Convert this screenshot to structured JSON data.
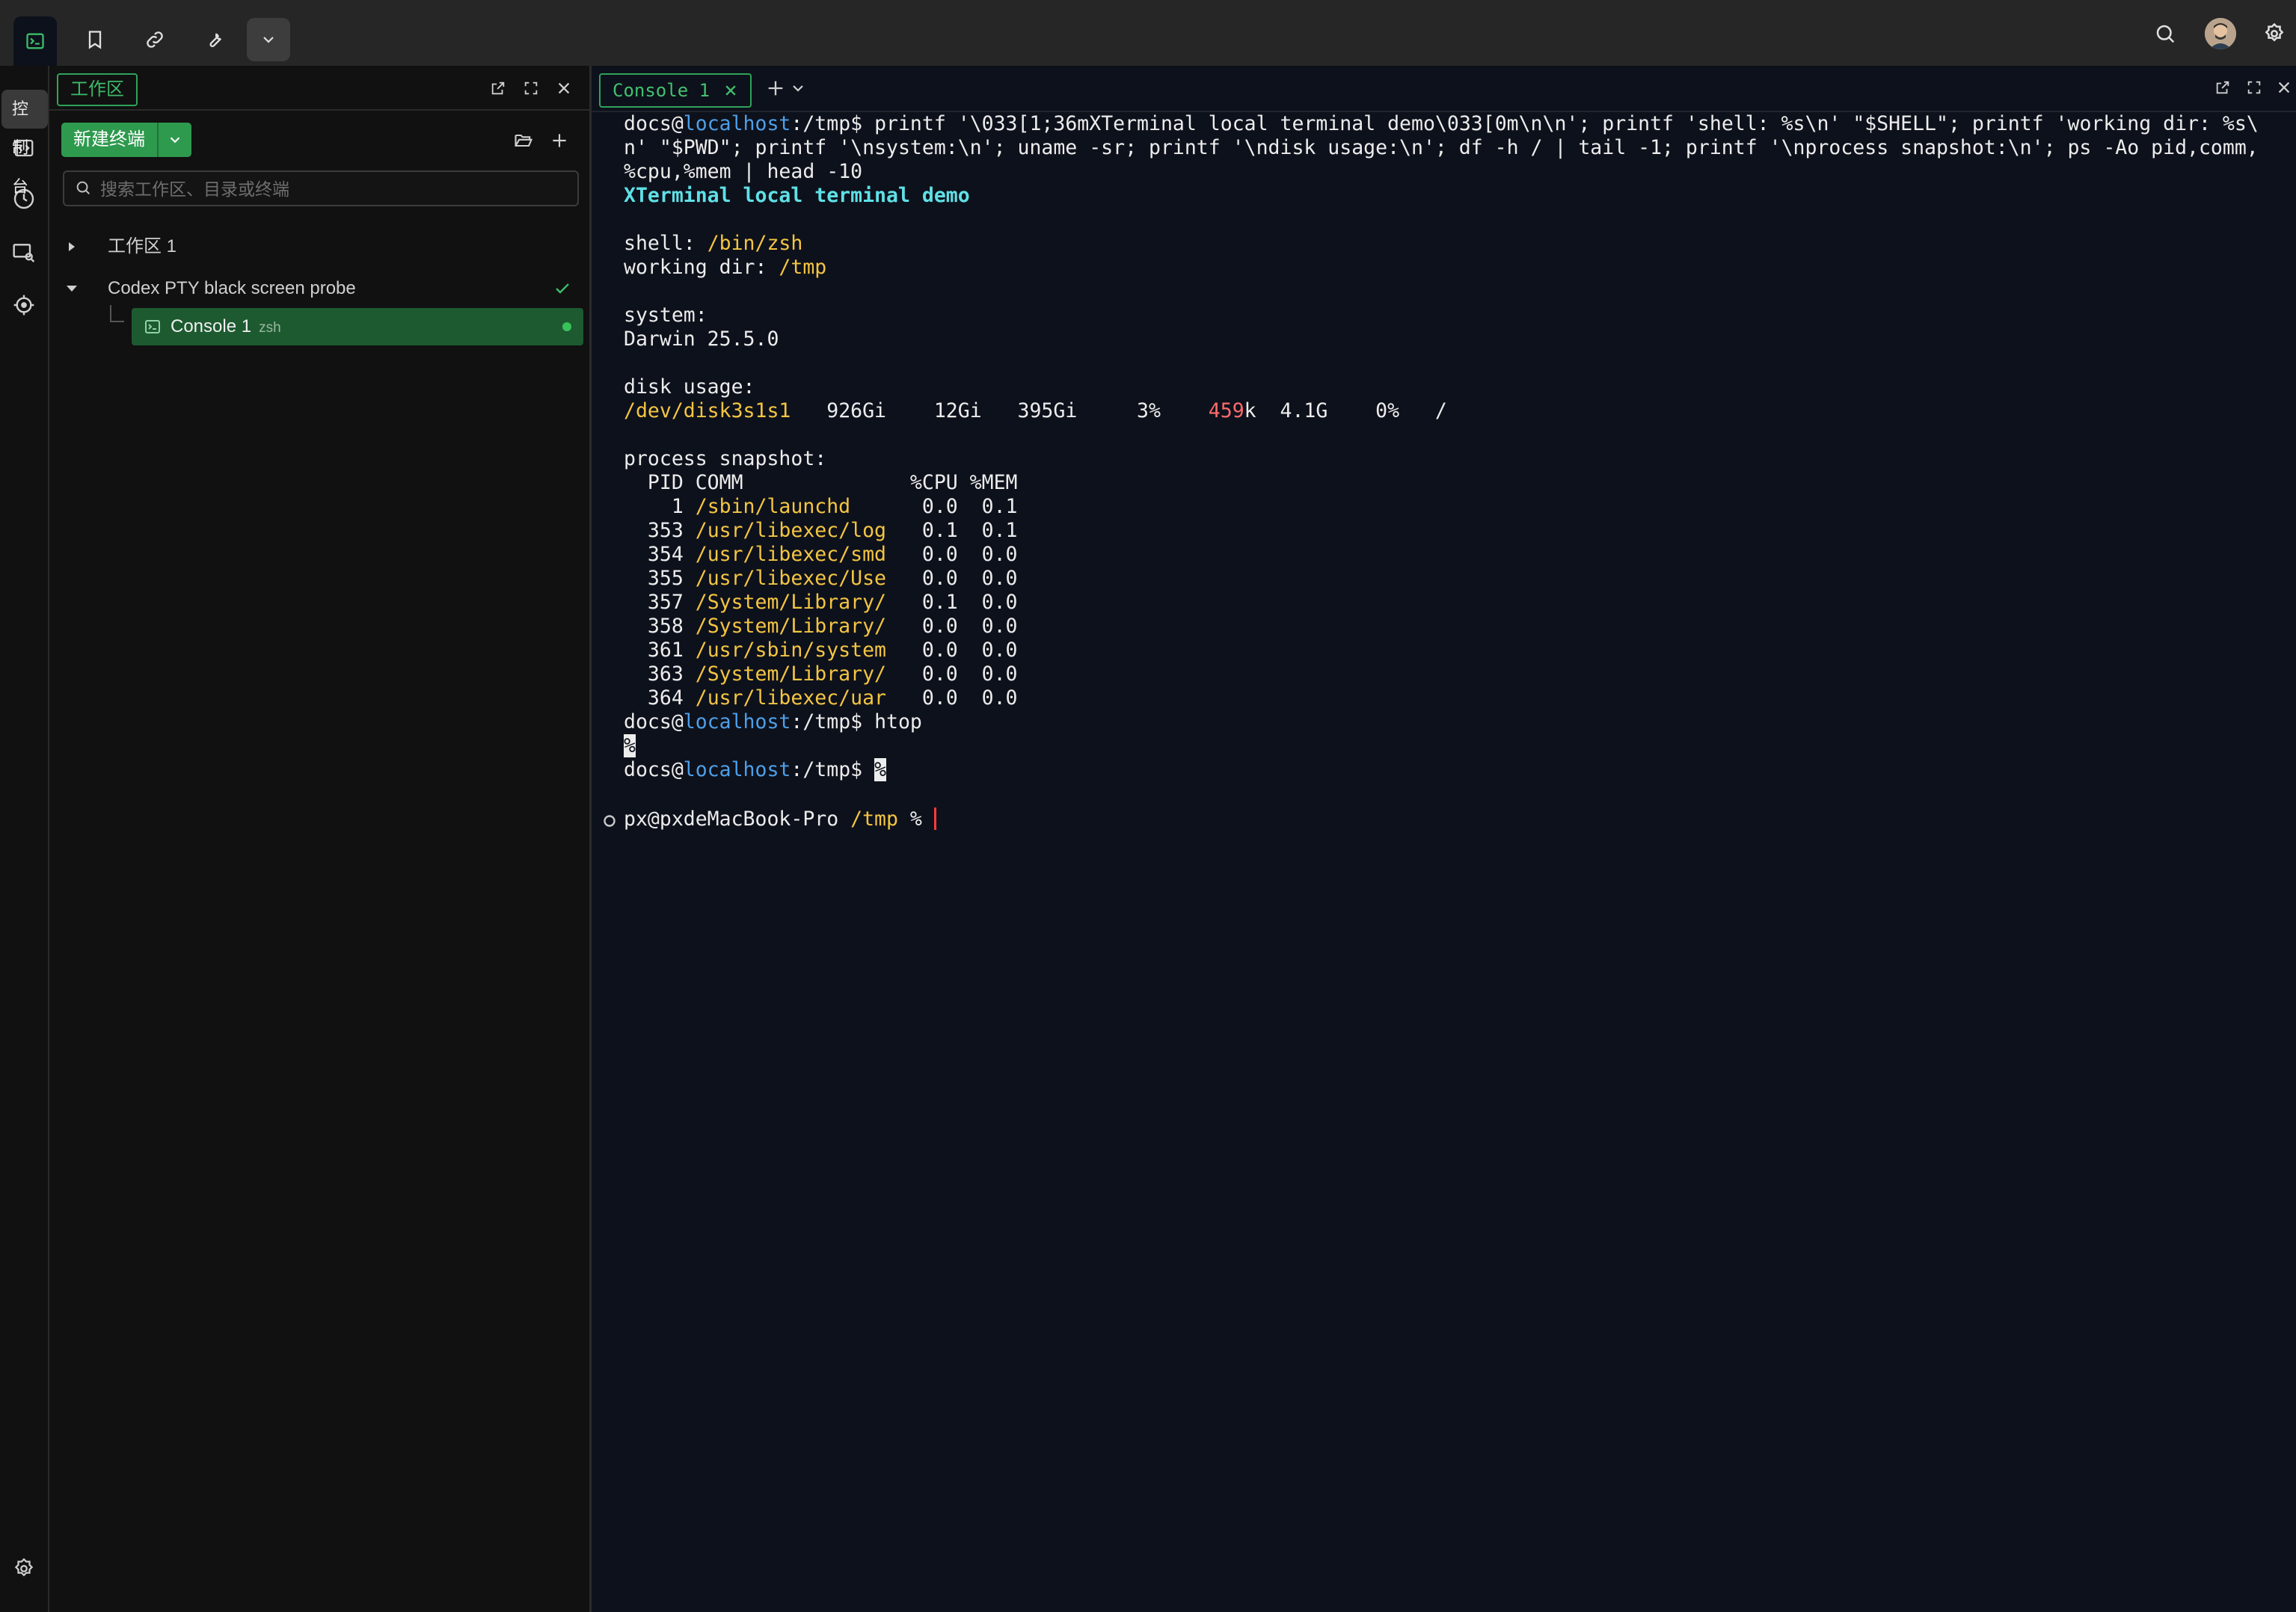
{
  "tooltip": "控制台",
  "sidebar": {
    "tab_label": "工作区",
    "new_terminal": "新建终端",
    "search_placeholder": "搜索工作区、目录或终端",
    "tree": [
      {
        "label": "工作区 1",
        "expanded": false
      },
      {
        "label": "Codex PTY black screen probe",
        "expanded": true
      }
    ],
    "session": {
      "label": "Console 1",
      "shell": "zsh"
    }
  },
  "terminal": {
    "tab_label": "Console 1",
    "cmd_user": "docs@",
    "cmd_host": "localhost",
    "cmd_path": ":/tmp$ ",
    "cmd_text_1": "printf '\\033[1;36mXTerminal local terminal demo\\033[0m\\n\\n'; printf 'shell: %s\\n' \"$SHELL\"; printf 'working dir: %s\\",
    "cmd_text_2": "n' \"$PWD\"; printf '\\nsystem:\\n'; uname -sr; printf '\\ndisk usage:\\n'; df -h / | tail -1; printf '\\nprocess snapshot:\\n'; ps -Ao pid,comm,",
    "cmd_text_3": "%cpu,%mem | head -10",
    "banner": "XTerminal local terminal demo",
    "shell_label": "shell: ",
    "shell_value": "/bin/zsh",
    "wd_label": "working dir: ",
    "wd_value": "/tmp",
    "system_label": "system:",
    "system_value": "Darwin 25.5.0",
    "disk_label": "disk usage:",
    "disk_device": "/dev/disk3s1s1",
    "disk_stats_1": "   926Gi    12Gi   395Gi     3%    ",
    "disk_inodes_hl": "459",
    "disk_stats_2": "k  4.1G    0%   /",
    "process_label": "process snapshot:",
    "process_header": "  PID COMM              %CPU %MEM",
    "processes": [
      {
        "pid": "    1 ",
        "comm": "/sbin/launchd     ",
        "stats": " 0.0  0.1"
      },
      {
        "pid": "  353 ",
        "comm": "/usr/libexec/log  ",
        "stats": " 0.1  0.1"
      },
      {
        "pid": "  354 ",
        "comm": "/usr/libexec/smd  ",
        "stats": " 0.0  0.0"
      },
      {
        "pid": "  355 ",
        "comm": "/usr/libexec/Use  ",
        "stats": " 0.0  0.0"
      },
      {
        "pid": "  357 ",
        "comm": "/System/Library/  ",
        "stats": " 0.1  0.0"
      },
      {
        "pid": "  358 ",
        "comm": "/System/Library/  ",
        "stats": " 0.0  0.0"
      },
      {
        "pid": "  361 ",
        "comm": "/usr/sbin/system  ",
        "stats": " 0.0  0.0"
      },
      {
        "pid": "  363 ",
        "comm": "/System/Library/  ",
        "stats": " 0.0  0.0"
      },
      {
        "pid": "  364 ",
        "comm": "/usr/libexec/uar  ",
        "stats": " 0.0  0.0"
      }
    ],
    "htop_cmd": "htop",
    "percent": "%",
    "final_prompt_user": "px@pxdeMacBook-Pro ",
    "final_prompt_path": "/tmp",
    "final_prompt_suffix": " % "
  }
}
